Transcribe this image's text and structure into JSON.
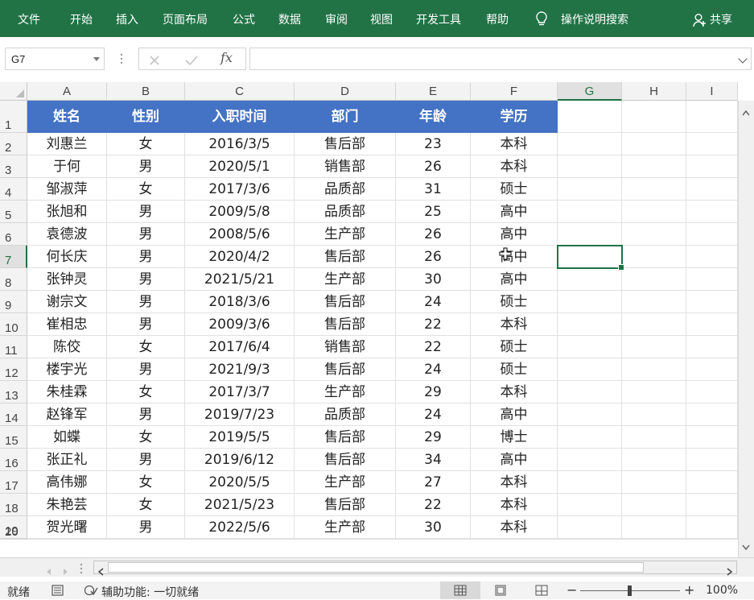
{
  "ribbon": {
    "tabs": [
      "文件",
      "开始",
      "插入",
      "页面布局",
      "公式",
      "数据",
      "审阅",
      "视图",
      "开发工具",
      "帮助"
    ],
    "search_label": "操作说明搜索",
    "share_label": "共享",
    "accent_color": "#217346"
  },
  "formula_bar": {
    "name_box": "G7",
    "fx_label": "fx",
    "formula_value": ""
  },
  "sheet": {
    "columns": [
      "A",
      "B",
      "C",
      "D",
      "E",
      "F",
      "G",
      "H",
      "I"
    ],
    "active_column": "G",
    "active_row": 7,
    "row_numbers": [
      "1",
      "2",
      "3",
      "4",
      "5",
      "6",
      "7",
      "8",
      "9",
      "10",
      "11",
      "12",
      "13",
      "14",
      "15",
      "16",
      "17",
      "18",
      "19",
      "20"
    ],
    "header": [
      "姓名",
      "性别",
      "入职时间",
      "部门",
      "年龄",
      "学历"
    ],
    "header_fill": "#4472c4",
    "rows": [
      [
        "刘惠兰",
        "女",
        "2016/3/5",
        "售后部",
        "23",
        "本科"
      ],
      [
        "于何",
        "男",
        "2020/5/1",
        "销售部",
        "26",
        "本科"
      ],
      [
        "邹淑萍",
        "女",
        "2017/3/6",
        "品质部",
        "31",
        "硕士"
      ],
      [
        "张旭和",
        "男",
        "2009/5/8",
        "品质部",
        "25",
        "高中"
      ],
      [
        "袁德波",
        "男",
        "2008/5/6",
        "生产部",
        "26",
        "高中"
      ],
      [
        "何长庆",
        "男",
        "2020/4/2",
        "售后部",
        "26",
        "高中"
      ],
      [
        "张钟灵",
        "男",
        "2021/5/21",
        "生产部",
        "30",
        "高中"
      ],
      [
        "谢宗文",
        "男",
        "2018/3/6",
        "售后部",
        "24",
        "硕士"
      ],
      [
        "崔相忠",
        "男",
        "2009/3/6",
        "售后部",
        "22",
        "本科"
      ],
      [
        "陈佼",
        "女",
        "2017/6/4",
        "销售部",
        "22",
        "硕士"
      ],
      [
        "楼宇光",
        "男",
        "2021/9/3",
        "售后部",
        "24",
        "硕士"
      ],
      [
        "朱桂霖",
        "女",
        "2017/3/7",
        "生产部",
        "29",
        "本科"
      ],
      [
        "赵锋军",
        "男",
        "2019/7/23",
        "品质部",
        "24",
        "高中"
      ],
      [
        "如蝶",
        "女",
        "2019/5/5",
        "售后部",
        "29",
        "博士"
      ],
      [
        "张正礼",
        "男",
        "2019/6/12",
        "售后部",
        "34",
        "高中"
      ],
      [
        "高伟娜",
        "女",
        "2020/5/5",
        "生产部",
        "27",
        "本科"
      ],
      [
        "朱艳芸",
        "女",
        "2021/5/23",
        "售后部",
        "22",
        "本科"
      ],
      [
        "贺光曙",
        "男",
        "2022/5/6",
        "生产部",
        "30",
        "本科"
      ]
    ]
  },
  "status": {
    "ready": "就绪",
    "accessibility": "辅助功能: 一切就绪",
    "zoom_minus": "−",
    "zoom_plus": "+",
    "zoom_level": "100%"
  }
}
